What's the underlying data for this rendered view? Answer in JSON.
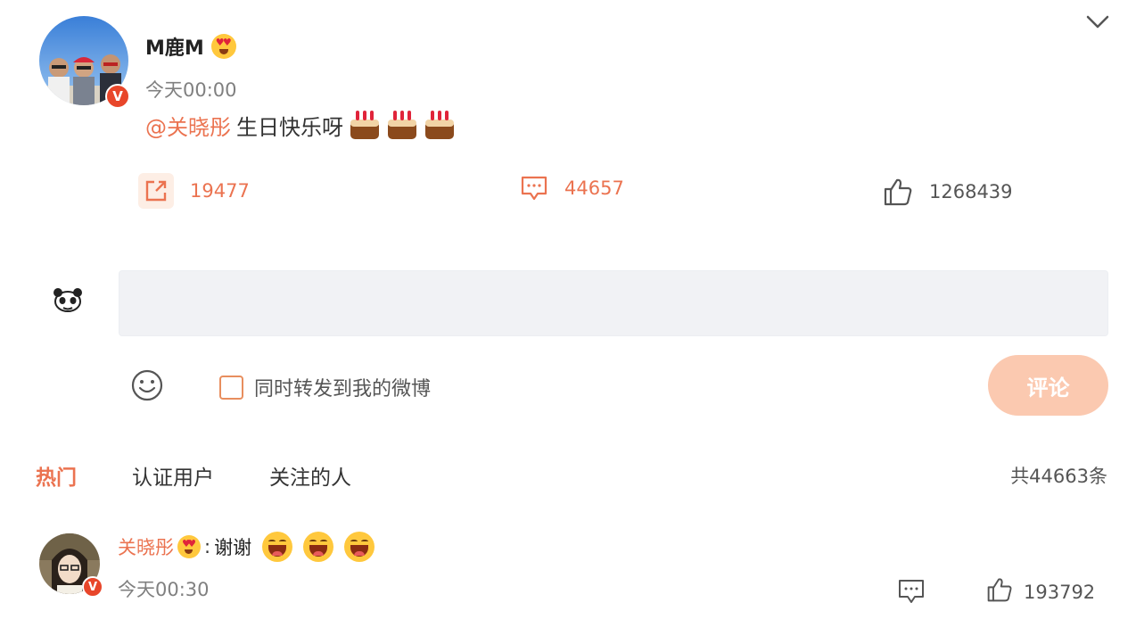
{
  "post": {
    "author": "M鹿M",
    "time": "今天00:00",
    "mention": "@关晓彤",
    "text": "生日快乐呀",
    "emojis": [
      "cake-icon",
      "cake-icon",
      "cake-icon"
    ],
    "verified": true
  },
  "actions": {
    "repost_count": "19477",
    "comment_count": "44657",
    "like_count": "1268439"
  },
  "composer": {
    "placeholder": "",
    "repost_label": "同时转发到我的微博",
    "repost_checked": false,
    "submit_label": "评论"
  },
  "tabs": [
    {
      "label": "热门",
      "active": true
    },
    {
      "label": "认证用户",
      "active": false
    },
    {
      "label": "关注的人",
      "active": false
    }
  ],
  "comments_total": "共44663条",
  "comments": [
    {
      "author": "关晓彤",
      "separator": ":",
      "text": "谢谢",
      "emojis": [
        "laugh-icon",
        "laugh-icon",
        "laugh-icon"
      ],
      "time": "今天00:30",
      "like_count": "193792",
      "verified": true
    }
  ],
  "colors": {
    "accent": "#eb7350",
    "submit_disabled": "#fbc9b0",
    "verified_badge": "#e8462a"
  }
}
